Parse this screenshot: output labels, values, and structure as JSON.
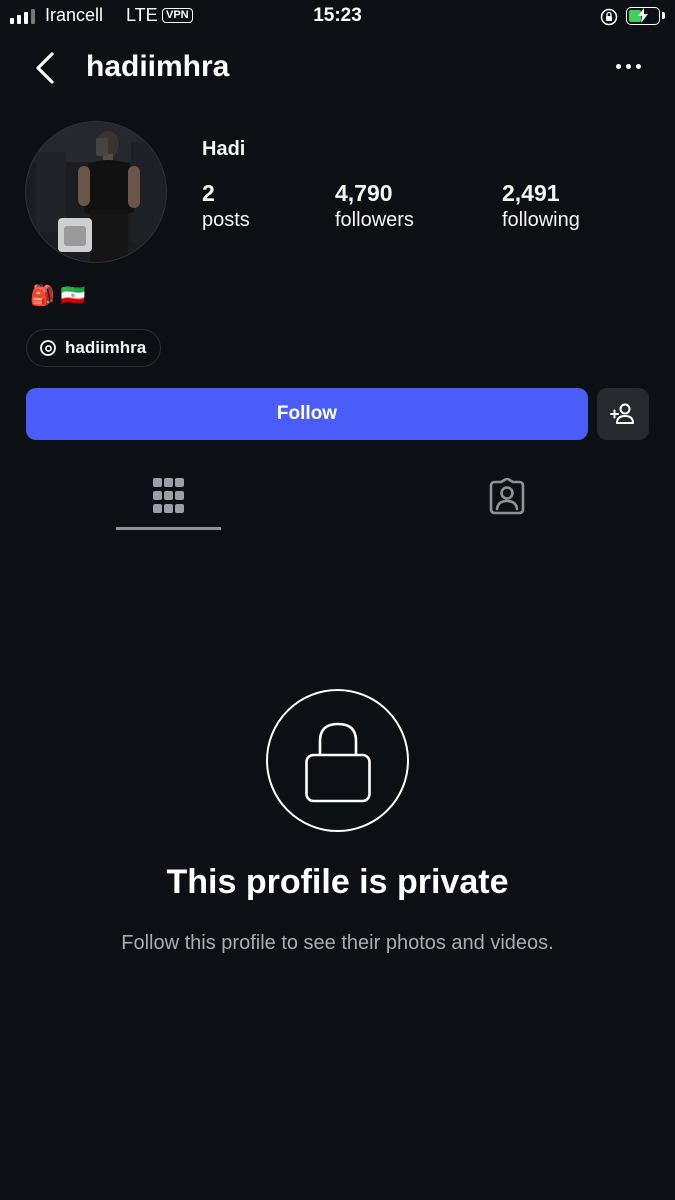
{
  "status_bar": {
    "carrier": "Irancell",
    "network": "LTE",
    "vpn": "VPN",
    "time": "15:23",
    "icons": [
      "signal-icon",
      "rotation-lock-icon",
      "battery-charging-icon"
    ]
  },
  "header": {
    "username": "hadiimhra",
    "icons": [
      "back-chevron-icon",
      "more-options-icon"
    ]
  },
  "profile": {
    "full_name": "Hadi",
    "stats": {
      "posts": {
        "value": "2",
        "label": "posts"
      },
      "followers": {
        "value": "4,790",
        "label": "followers"
      },
      "following": {
        "value": "2,491",
        "label": "following"
      }
    },
    "bio_emoji": "🎒 🇮🇷",
    "threads_handle": "hadiimhra"
  },
  "actions": {
    "follow_label": "Follow",
    "suggest_icon": "add-person-icon"
  },
  "tabs": [
    {
      "icon": "grid-icon",
      "active": true
    },
    {
      "icon": "tagged-person-icon",
      "active": false
    }
  ],
  "private": {
    "title": "This profile is private",
    "subtitle": "Follow this profile to see their photos and videos.",
    "icon": "lock-icon"
  },
  "colors": {
    "background": "#0c1014",
    "follow_button": "#4a5df9",
    "secondary_button": "#262a2f",
    "muted_text": "#a8adb3",
    "battery_fill": "#3bd15a"
  },
  "battery_level": 0.45
}
